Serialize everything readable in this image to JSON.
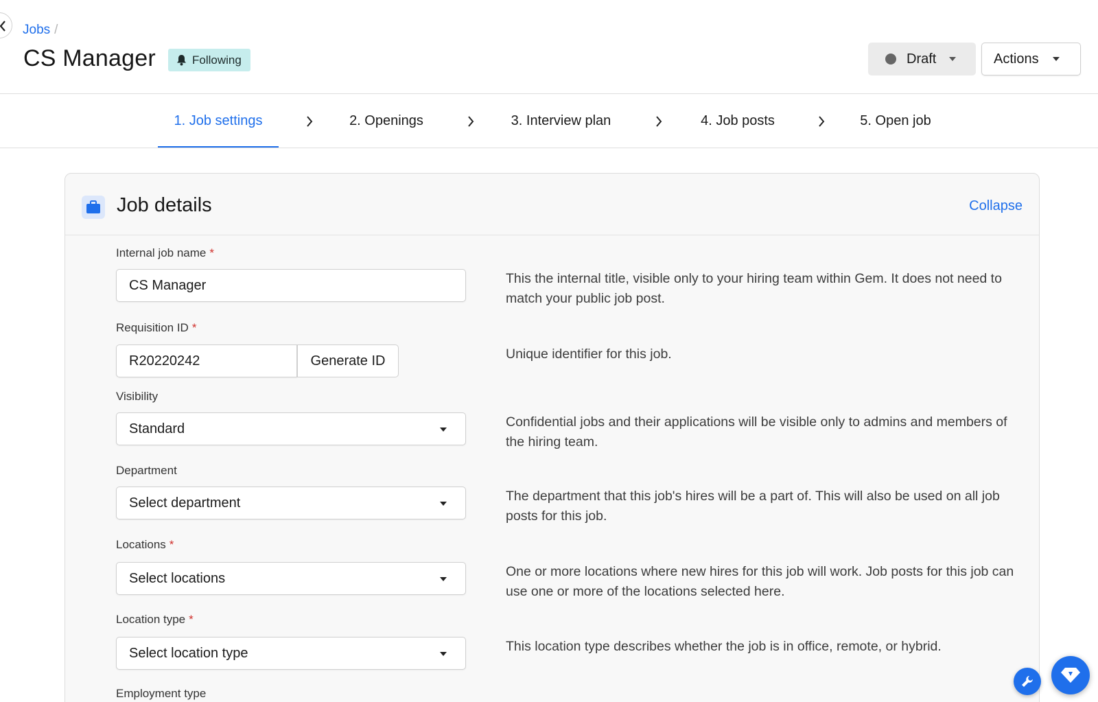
{
  "breadcrumb": {
    "link": "Jobs",
    "separator": "/"
  },
  "header": {
    "title": "CS Manager",
    "following_label": "Following",
    "status_label": "Draft",
    "actions_label": "Actions"
  },
  "steps": [
    {
      "label": "1. Job settings",
      "active": true
    },
    {
      "label": "2. Openings",
      "active": false
    },
    {
      "label": "3. Interview plan",
      "active": false
    },
    {
      "label": "4. Job posts",
      "active": false
    },
    {
      "label": "5. Open job",
      "active": false
    }
  ],
  "card": {
    "title": "Job details",
    "collapse_label": "Collapse"
  },
  "fields": {
    "internal_name": {
      "label": "Internal job name",
      "value": "CS Manager",
      "help": "This the internal title, visible only to your hiring team within Gem. It does not need to match your public job post."
    },
    "requisition": {
      "label": "Requisition ID",
      "value": "R20220242",
      "button": "Generate ID",
      "help": "Unique identifier for this job."
    },
    "visibility": {
      "label": "Visibility",
      "value": "Standard",
      "help": "Confidential jobs and their applications will be visible only to admins and members of the hiring team."
    },
    "department": {
      "label": "Department",
      "value": "Select department",
      "help": "The department that this job's hires will be a part of. This will also be used on all job posts for this job."
    },
    "locations": {
      "label": "Locations",
      "value": "Select locations",
      "help": "One or more locations where new hires for this job will work. Job posts for this job can use one or more of the locations selected here."
    },
    "location_type": {
      "label": "Location type",
      "value": "Select location type",
      "help": "This location type describes whether the job is in office, remote, or hybrid."
    },
    "employment_type": {
      "label": "Employment type"
    }
  },
  "required_mark": "*",
  "colors": {
    "accent": "#1f6feb",
    "following_bg": "#c6eded",
    "required": "#d0312d"
  },
  "icons": [
    "back-icon",
    "bell-icon",
    "briefcase-icon",
    "chevron-right-icon",
    "caret-down-icon",
    "wrench-icon",
    "gem-icon"
  ]
}
